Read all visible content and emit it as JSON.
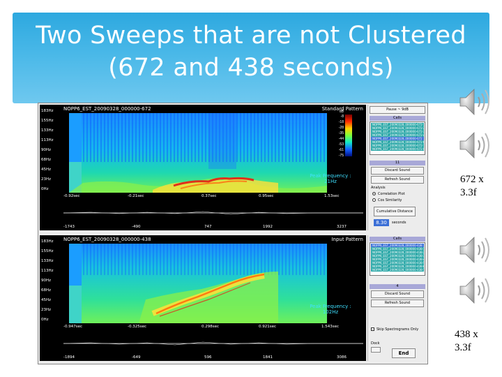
{
  "slide": {
    "title_line1": "Two Sweeps that are not Clustered",
    "title_line2": "(672 and 438 seconds)",
    "accent_color": "#2da8df",
    "caption_top": [
      "672 x",
      "3.3f"
    ],
    "caption_bottom": [
      "438 x",
      "3.3f"
    ],
    "speaker_icons": [
      "speaker-icon",
      "speaker-icon",
      "speaker-icon",
      "speaker-icon"
    ]
  },
  "app": {
    "plot_top": {
      "file_label": "NOPP6_EST_20090328_000000-672",
      "pattern_label": "Standard Pattern",
      "y_ticks": [
        "183Hz",
        "155Hz",
        "133Hz",
        "113Hz",
        "90Hz",
        "68Hz",
        "45Hz",
        "23Hz",
        "0Hz"
      ],
      "time_ticks": [
        "-0.92sec",
        "-0.21sec",
        "0.37sec",
        "0.95sec",
        "1.53sec"
      ],
      "bottom_ticks": [
        "-1743",
        "-490",
        "747",
        "1992",
        "3237"
      ],
      "peak_label": "Peak Frequency :",
      "peak_value": "21Hz",
      "scale_unit": "dB",
      "scale_ticks": [
        "-8",
        "-18",
        "-28",
        "-35",
        "-44",
        "-53",
        "-61",
        "-75"
      ]
    },
    "plot_bottom": {
      "file_label": "NOPP6_EST_20090328_000000-438",
      "pattern_label": "Input Pattern",
      "y_ticks": [
        "183Hz",
        "155Hz",
        "133Hz",
        "113Hz",
        "90Hz",
        "68Hz",
        "45Hz",
        "23Hz",
        "0Hz"
      ],
      "time_ticks": [
        "-0.947sec",
        "-0.325sec",
        "0.298sec",
        "0.921sec",
        "1.543sec"
      ],
      "bottom_ticks": [
        "-1894",
        "-649",
        "596",
        "1841",
        "3086"
      ],
      "peak_label": "Peak Frequency :",
      "peak_value": "102Hz"
    },
    "panel_top": {
      "top_button": "Pause ~ 9dB",
      "list_header": "Calls",
      "list_items": [
        "NOPP6_EST_20090328_000000-672-1",
        "NOPP6_EST_20090328_000000-672-2",
        "NOPP6_EST_20090328_000000-672-3",
        "NOPP6_EST_20090328_000000-672-4",
        "NOPP6_EST_20090328_000000-672",
        "NOPP6_EST_20090328_000000-672-6",
        "NOPP6_EST_20090328_000000-672-7",
        "NOPP6_EST_20090328_000000-672-8"
      ],
      "selected_index": 4,
      "count": "11",
      "discard_button": "Discard Sound",
      "refresh_button": "Refresh Sound",
      "analysis_label": "Analysis",
      "radio_1": "Correlation Plot",
      "radio_2": "Cos Similarity",
      "distance_button": "Cumulative Distance",
      "distance_value": "8.30",
      "distance_unit": "seconds"
    },
    "panel_bottom": {
      "list_header": "Calls",
      "list_items": [
        "NOPP6_EST_20090328_000000-438",
        "NOPP6_EST_20090328_000000-438-1",
        "NOPP6_EST_20090328_000000-438-2",
        "NOPP6_EST_20090328_000000-438-3",
        "NOPP6_EST_20090328_000000-438-4",
        "NOPP6_EST_20090328_000000-438-5",
        "NOPP6_EST_20090328_000000-438-6",
        "NOPP6_EST_20090328_000000-438-7"
      ],
      "selected_index": 0,
      "count": "4",
      "discard_button": "Discard Sound",
      "refresh_button": "Refresh Sound",
      "checkbox_label": "Skip Spectrograms Only",
      "small_label": "Dock",
      "end_button": "End"
    }
  }
}
